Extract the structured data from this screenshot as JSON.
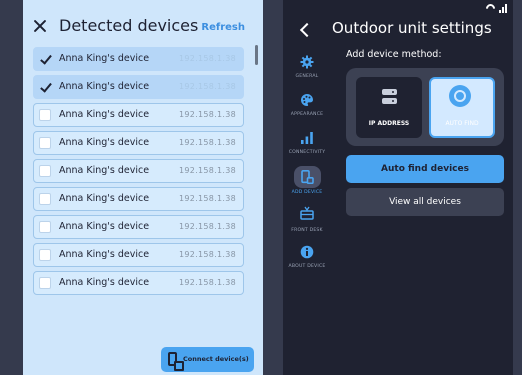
{
  "colors": {
    "accent": "#4aa4f0",
    "left_panel_bg": "#cfe6fb",
    "right_panel_bg": "#1f2231",
    "page_bg": "#353a4d"
  },
  "detected": {
    "title": "Detected devices",
    "refresh_label": "Refresh",
    "devices": [
      {
        "name": "Anna King's device",
        "ip": "192.158.1.38",
        "checked": true
      },
      {
        "name": "Anna King's device",
        "ip": "192.158.1.38",
        "checked": true
      },
      {
        "name": "Anna King's device",
        "ip": "192.158.1.38",
        "checked": false
      },
      {
        "name": "Anna King's device",
        "ip": "192.158.1.38",
        "checked": false
      },
      {
        "name": "Anna King's device",
        "ip": "192.158.1.38",
        "checked": false
      },
      {
        "name": "Anna King's device",
        "ip": "192.158.1.38",
        "checked": false
      },
      {
        "name": "Anna King's device",
        "ip": "192.158.1.38",
        "checked": false
      },
      {
        "name": "Anna King's device",
        "ip": "192.158.1.38",
        "checked": false
      },
      {
        "name": "Anna King's device",
        "ip": "192.158.1.38",
        "checked": false
      }
    ],
    "connect_label": "Connect device(s)"
  },
  "settings": {
    "title": "Outdoor unit settings",
    "nav": [
      {
        "label": "GENERAL",
        "icon": "gear-icon",
        "active": false
      },
      {
        "label": "APPEARANCE",
        "icon": "palette-icon",
        "active": false
      },
      {
        "label": "CONNECTIVITY",
        "icon": "signal-bars-icon",
        "active": false
      },
      {
        "label": "ADD DEVICE",
        "icon": "add-device-icon",
        "active": true
      },
      {
        "label": "FRONT DESK",
        "icon": "front-desk-icon",
        "active": false
      },
      {
        "label": "ABOUT DEVICE",
        "icon": "info-icon",
        "active": false
      }
    ],
    "method_label": "Add device method:",
    "methods": [
      {
        "label": "IP ADDRESS",
        "icon": "server-icon",
        "selected": false
      },
      {
        "label": "AUTO FIND",
        "icon": "target-icon",
        "selected": true
      }
    ],
    "primary_button": "Auto find devices",
    "secondary_button": "View all devices"
  }
}
